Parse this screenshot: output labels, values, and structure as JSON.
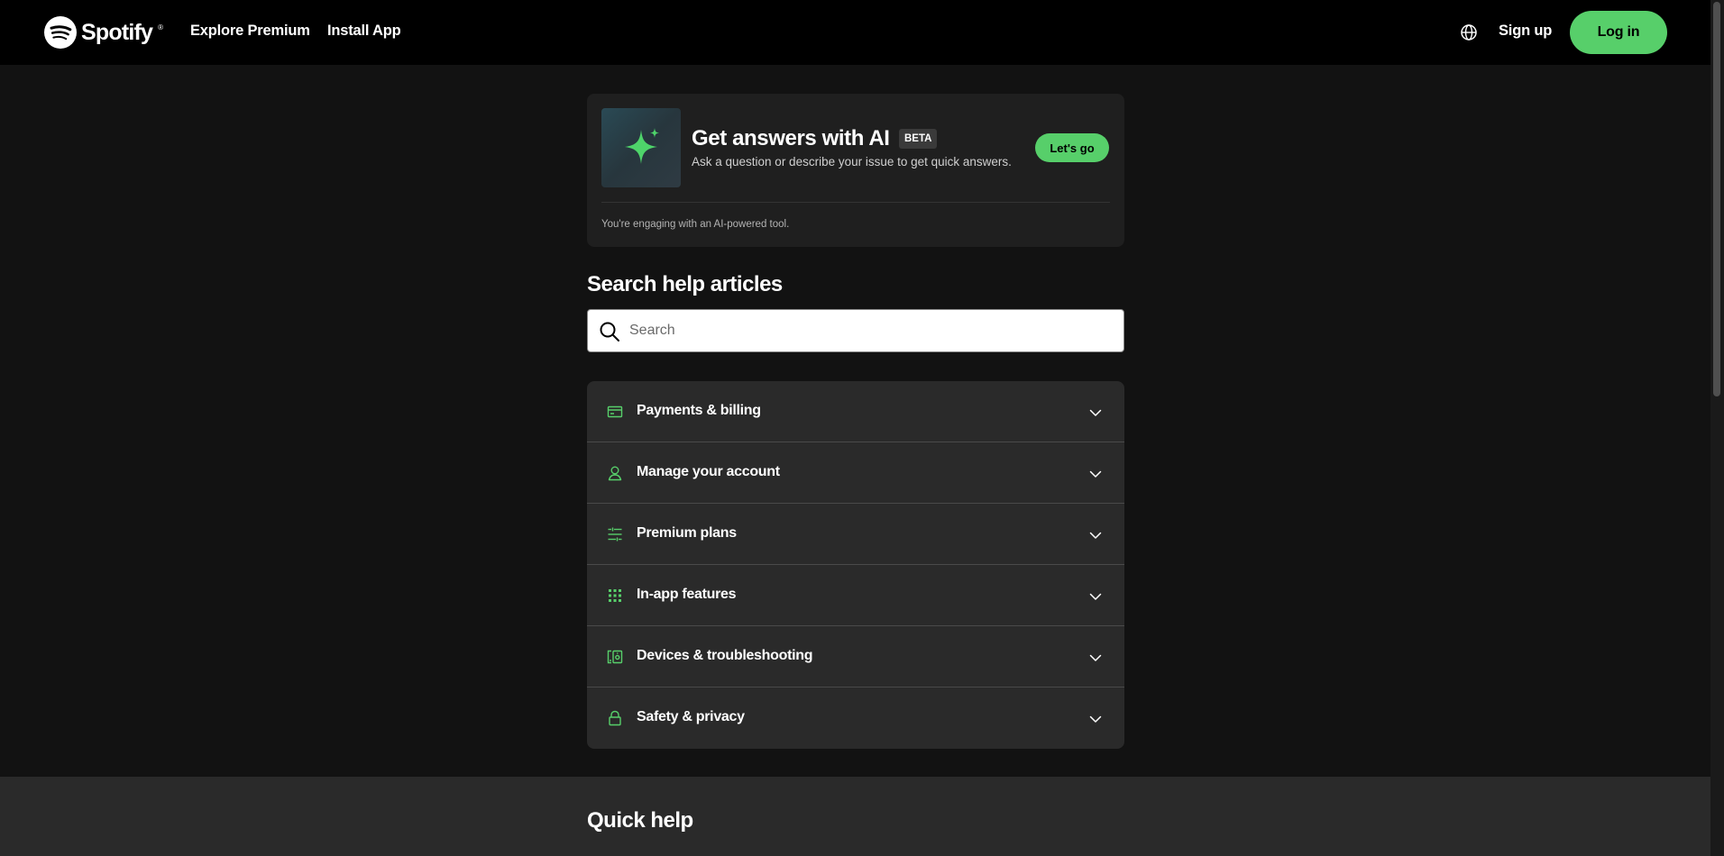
{
  "header": {
    "logo_text": "Spotify",
    "logo_reg": "®",
    "nav": [
      "Explore Premium",
      "Install App"
    ],
    "language_icon": "globe-icon",
    "signup_label": "Sign up",
    "login_label": "Log in"
  },
  "ai_card": {
    "icon": "sparkle-icon",
    "title": "Get answers with AI",
    "badge": "BETA",
    "subtitle": "Ask a question or describe your issue to get quick answers.",
    "button_label": "Let's go",
    "note": "You're engaging with an AI-powered tool."
  },
  "search": {
    "heading": "Search help articles",
    "placeholder": "Search",
    "value": ""
  },
  "categories": [
    {
      "label": "Payments & billing",
      "icon": "credit-card-icon"
    },
    {
      "label": "Manage your account",
      "icon": "user-icon"
    },
    {
      "label": "Premium plans",
      "icon": "list-settings-icon"
    },
    {
      "label": "In-app features",
      "icon": "grid-icon"
    },
    {
      "label": "Devices & troubleshooting",
      "icon": "devices-icon"
    },
    {
      "label": "Safety & privacy",
      "icon": "lock-icon"
    }
  ],
  "quick_help": {
    "title": "Quick help"
  },
  "colors": {
    "accent": "#57cf6a",
    "background": "#121212",
    "header": "#000000",
    "card": "#1f1f1f",
    "category_bg": "#2a2a2a"
  }
}
